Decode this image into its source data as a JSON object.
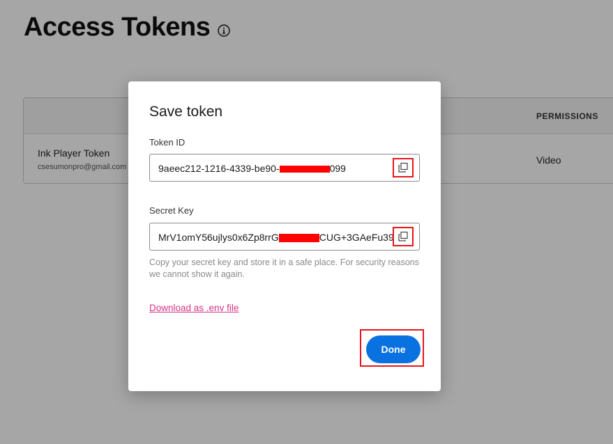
{
  "page": {
    "title": "Access Tokens"
  },
  "table": {
    "columns": [
      "PERMISSIONS"
    ],
    "rows": [
      {
        "name": "Ink Player Token",
        "email": "csesumonpro@gmail.com",
        "permissions": "Video"
      }
    ]
  },
  "modal": {
    "title": "Save token",
    "token_id_label": "Token ID",
    "token_id_value_start": "9aeec212-1216-4339-be90-",
    "token_id_value_end": "099",
    "secret_key_label": "Secret Key",
    "secret_key_value_start": "MrV1omY56ujlys0x6Zp8rrG",
    "secret_key_value_end": "CUG+3GAeFu39",
    "helper_text": "Copy your secret key and store it in a safe place. For security reasons we cannot show it again.",
    "download_label": "Download as .env file",
    "done_label": "Done"
  },
  "colors": {
    "primary": "#0a72e0",
    "link": "#d63384",
    "highlight": "#e8141b",
    "redaction": "#ff0000"
  },
  "icons": {
    "info": "info-circle-icon",
    "copy": "copy-icon"
  }
}
